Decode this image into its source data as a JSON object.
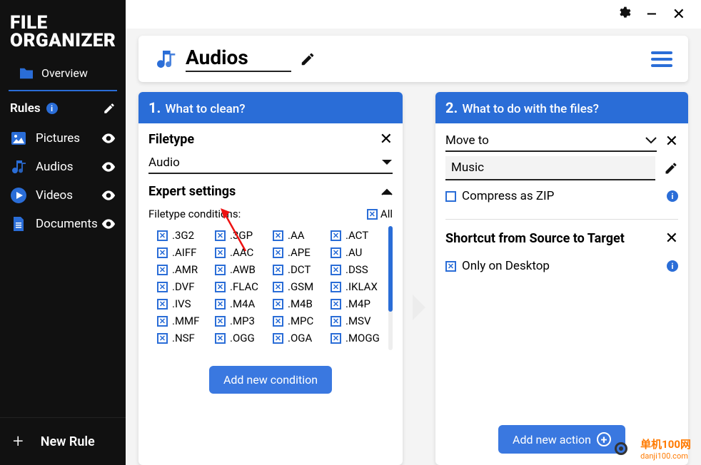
{
  "app_title_line1": "File",
  "app_title_line2": "Organizer",
  "sidebar": {
    "overview": "Overview",
    "rules_label": "Rules",
    "items": [
      {
        "label": "Pictures"
      },
      {
        "label": "Audios"
      },
      {
        "label": "Videos"
      },
      {
        "label": "Documents"
      }
    ],
    "new_rule": "New Rule"
  },
  "header": {
    "rule_name": "Audios"
  },
  "panel1": {
    "step": "1.",
    "title": "What to clean?",
    "filetype_label": "Filetype",
    "filetype_value": "Audio",
    "expert_label": "Expert settings",
    "conditions_label": "Filetype conditions:",
    "all_label": "All",
    "extensions": [
      ".3G2",
      ".3GP",
      ".AA",
      ".ACT",
      ".AIFF",
      ".AAC",
      ".APE",
      ".AU",
      ".AMR",
      ".AWB",
      ".DCT",
      ".DSS",
      ".DVF",
      ".FLAC",
      ".GSM",
      ".IKLAX",
      ".IVS",
      ".M4A",
      ".M4B",
      ".M4P",
      ".MMF",
      ".MP3",
      ".MPC",
      ".MSV",
      ".NSF",
      ".OGG",
      ".OGA",
      ".MOGG"
    ],
    "add_button": "Add new condition"
  },
  "panel2": {
    "step": "2.",
    "title": "What to do with the files?",
    "action_value": "Move to",
    "target_value": "Music",
    "compress_label": "Compress as ZIP",
    "compress_checked": false,
    "shortcut_title": "Shortcut from Source to Target",
    "shortcut_option": "Only on Desktop",
    "shortcut_checked": true,
    "add_button": "Add new action"
  },
  "watermark": {
    "name": "单机100网",
    "url": "danji100.com"
  }
}
